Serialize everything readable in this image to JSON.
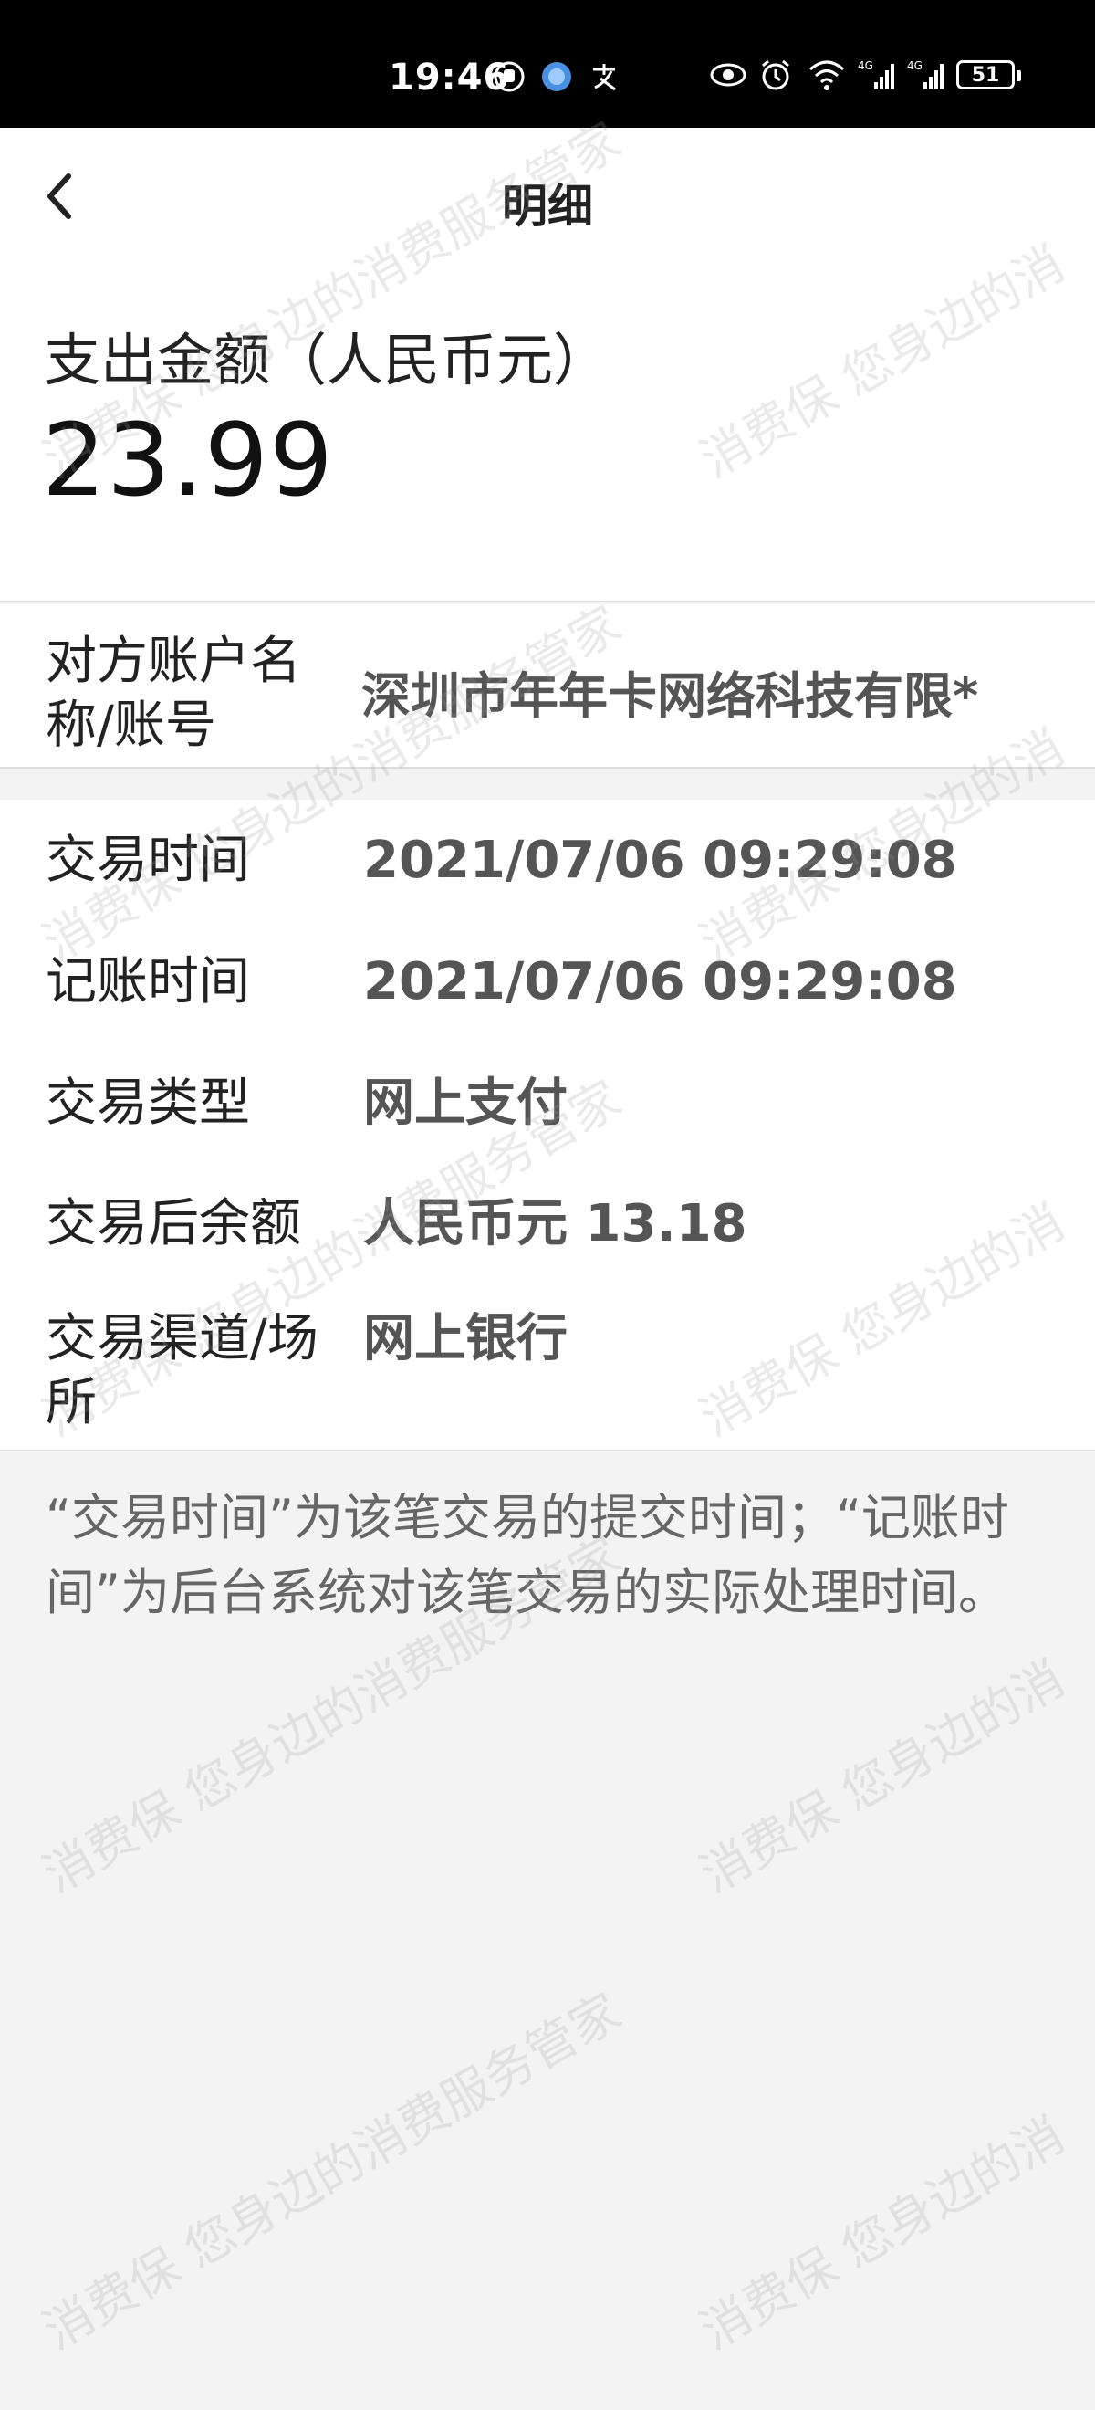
{
  "status_bar": {
    "time": "19:46",
    "battery": "51",
    "left_icons": [
      "hand-icon",
      "browser-icon",
      "alipay-icon"
    ],
    "right_icons": [
      "eye-icon",
      "alarm-icon",
      "wifi-icon",
      "signal-4g-icon",
      "signal-4g-icon"
    ]
  },
  "nav": {
    "title": "明细"
  },
  "amount": {
    "label": "支出金额（人民币元）",
    "value": "23.99"
  },
  "counterparty": {
    "label": "对方账户名称/账号",
    "value": "深圳市年年卡网络科技有限*"
  },
  "details": [
    {
      "label": "交易时间",
      "value": "2021/07/06  09:29:08"
    },
    {
      "label": "记账时间",
      "value": "2021/07/06  09:29:08"
    },
    {
      "label": "交易类型",
      "value": "网上支付"
    },
    {
      "label": "交易后余额",
      "value": "人民币元 13.18"
    },
    {
      "label": "交易渠道/场所",
      "value": "网上银行"
    }
  ],
  "note": "“交易时间”为该笔交易的提交时间；“记账时间”为后台系统对该笔交易的实际处理时间。",
  "watermark": {
    "text_a": "消费保 您身边的消费服务管家",
    "text_b": "消费保 您身边的消"
  }
}
